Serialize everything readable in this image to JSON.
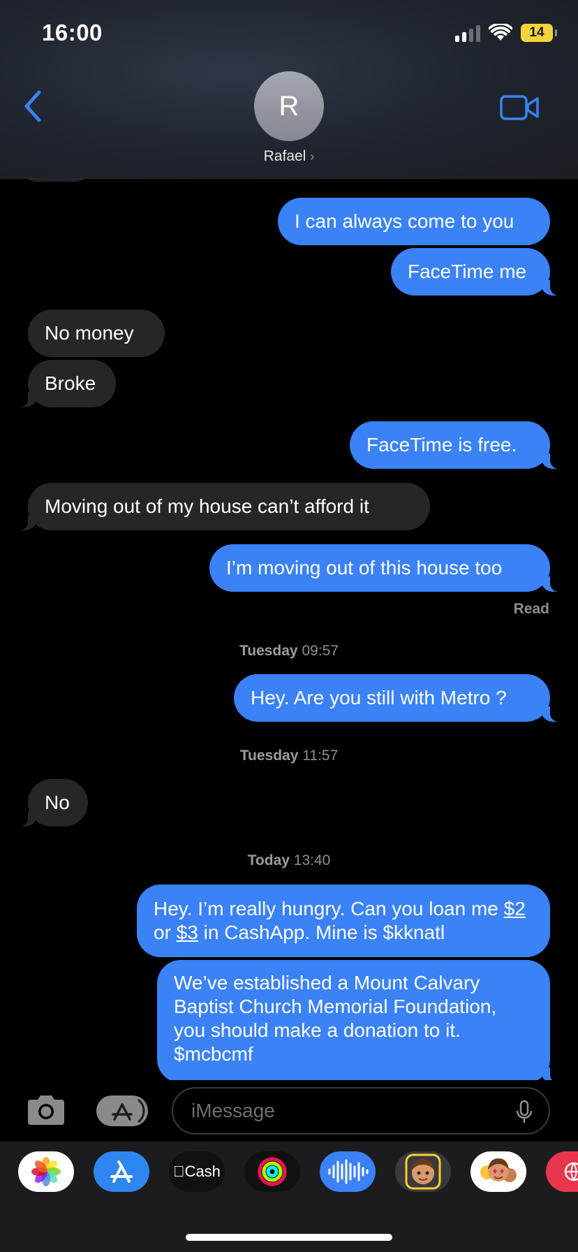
{
  "status": {
    "time": "16:00",
    "battery": "14"
  },
  "header": {
    "avatar_initial": "R",
    "contact_name": "Rafael"
  },
  "messages": [
    {
      "dir": "out",
      "text": "I can always come to you"
    },
    {
      "dir": "out",
      "text": "FaceTime me"
    },
    {
      "dir": "in",
      "text": "No money"
    },
    {
      "dir": "in",
      "text": "Broke"
    },
    {
      "dir": "out",
      "text": "FaceTime is free."
    },
    {
      "dir": "in",
      "text": "Moving out of my house can’t afford it"
    },
    {
      "dir": "out",
      "text": "I’m moving out of this house too"
    },
    {
      "dir": "out",
      "text": "Hey. Are you still with Metro ?"
    },
    {
      "dir": "in",
      "text": "No"
    },
    {
      "dir": "out",
      "parts": [
        "Hey. I’m really hungry. Can you loan me",
        "$2",
        "or",
        "$3",
        "in CashApp. Mine is $kknatl"
      ]
    },
    {
      "dir": "out",
      "text": "We’ve established a Mount Calvary Baptist Church Memorial Foundation, you should make a donation to it. $mcbcmf"
    }
  ],
  "read_receipt": "Read",
  "timestamps": [
    {
      "day": "Tuesday",
      "time": "09:57"
    },
    {
      "day": "Tuesday",
      "time": "11:57"
    },
    {
      "day": "Today",
      "time": "13:40"
    }
  ],
  "input": {
    "placeholder": "iMessage"
  },
  "drawer": {
    "cash_label": "Cash"
  },
  "colors": {
    "outgoing": "#3a82f6",
    "incoming": "#262628",
    "accent": "#3a82f6"
  }
}
